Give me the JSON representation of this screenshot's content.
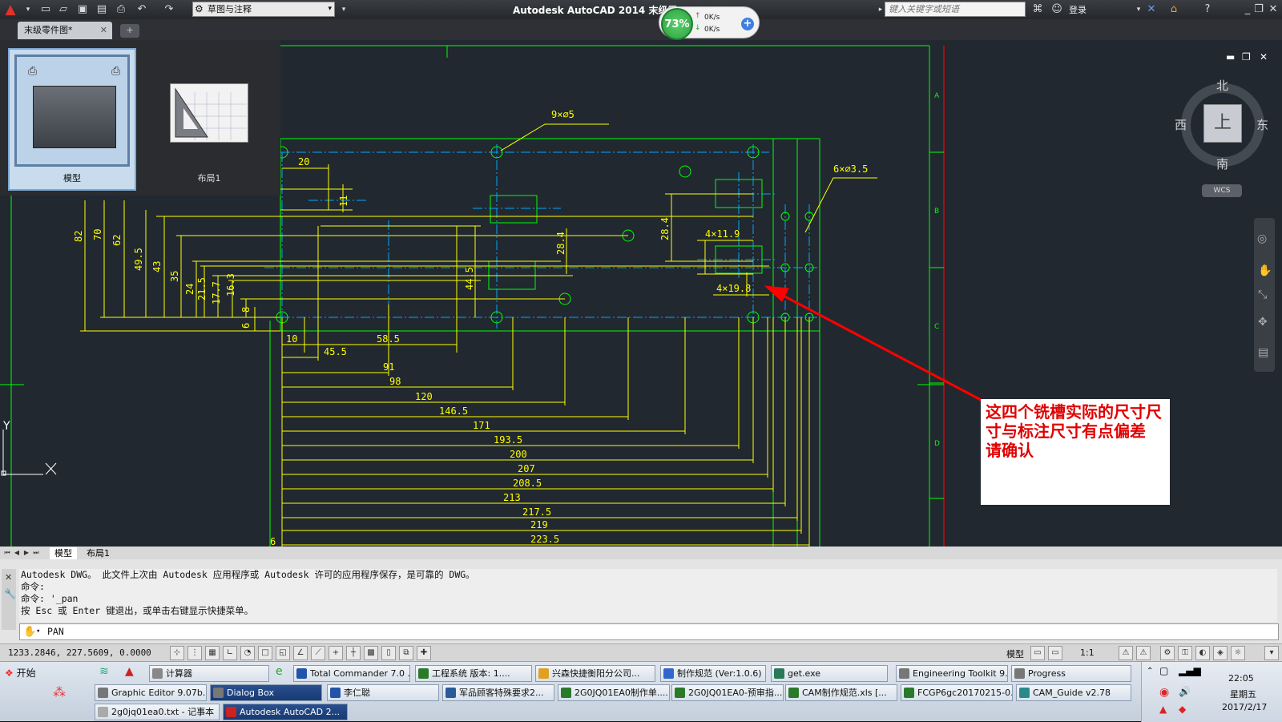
{
  "titlebar": {
    "workspace": "草图与注释",
    "app_title": "Autodesk AutoCAD 2014    末级零",
    "search_placeholder": "键入关键字或短语",
    "signin": "登录"
  },
  "netmeter": {
    "percent": "73%",
    "up": "0K/s",
    "down": "0K/s"
  },
  "doc_tab": {
    "label": "末级零件图*"
  },
  "preview": {
    "model_label": "模型",
    "layout_label": "布局1"
  },
  "viewcube": {
    "north": "北",
    "south": "南",
    "east": "东",
    "west": "西",
    "face": "上",
    "wcs": "WCS"
  },
  "drawing": {
    "callouts": [
      "9×⌀5",
      "6×⌀3.5",
      "4×11.9",
      "4×19.8"
    ],
    "left_dims": [
      "82",
      "70",
      "62",
      "49.5",
      "43",
      "35",
      "24",
      "21.5",
      "17.7",
      "16.3",
      "8",
      "6"
    ],
    "inner_dims": [
      "11",
      "28.4",
      "44.5",
      "28.4"
    ],
    "top_dim": "20",
    "bottom_dims": [
      "10",
      "58.5",
      "45.5",
      "91",
      "98",
      "120",
      "146.5",
      "171",
      "193.5",
      "200",
      "207",
      "208.5",
      "213",
      "217.5",
      "219",
      "223.5"
    ],
    "border_letters": [
      "A",
      "B",
      "C",
      "D"
    ],
    "left_edge_number": "6",
    "ucs_y": "Y"
  },
  "annotation": {
    "text": "这四个铣槽实际的尺寸尺寸与标注尺寸有点偏差   请确认"
  },
  "layout_tabs": [
    "模型",
    "布局1"
  ],
  "command": {
    "history": [
      "Autodesk DWG。  此文件上次由 Autodesk 应用程序或 Autodesk 许可的应用程序保存，是可靠的 DWG。",
      "命令:",
      "命令: '_pan",
      "按 Esc 或 Enter 键退出，或单击右键显示快捷菜单。"
    ],
    "current": "PAN"
  },
  "statusbar": {
    "coords": "1233.2846, 227.5609, 0.0000",
    "model": "模型",
    "scale": "1:1"
  },
  "taskbar": {
    "start": "开始",
    "row1": [
      "计算器",
      "Total Commander 7.0 ...",
      "工程系统  版本: 1....",
      "兴森快捷衡阳分公司...",
      "制作规范 (Ver:1.0.6)",
      "get.exe",
      "Engineering Toolkit 9....",
      "Progress"
    ],
    "row2": [
      "Graphic Editor 9.07b...",
      "Dialog Box",
      "李仁聪",
      "军品顾客特殊要求2...",
      "2G0JQ01EA0制作单....",
      "2G0JQ01EA0-预审指...",
      "CAM制作规范.xls [...",
      "FCGP6gc20170215-0...",
      "CAM_Guide v2.78"
    ],
    "row3": [
      "2g0jq01ea0.txt - 记事本",
      "Autodesk AutoCAD 2..."
    ],
    "time": "22:05",
    "weekday": "星期五",
    "date": "2017/2/17"
  },
  "colors": {
    "dim_yellow": "#ffff00",
    "geom_green": "#00ff00",
    "center_cyan": "#00c0ff",
    "arrow_red": "#ff0000"
  }
}
